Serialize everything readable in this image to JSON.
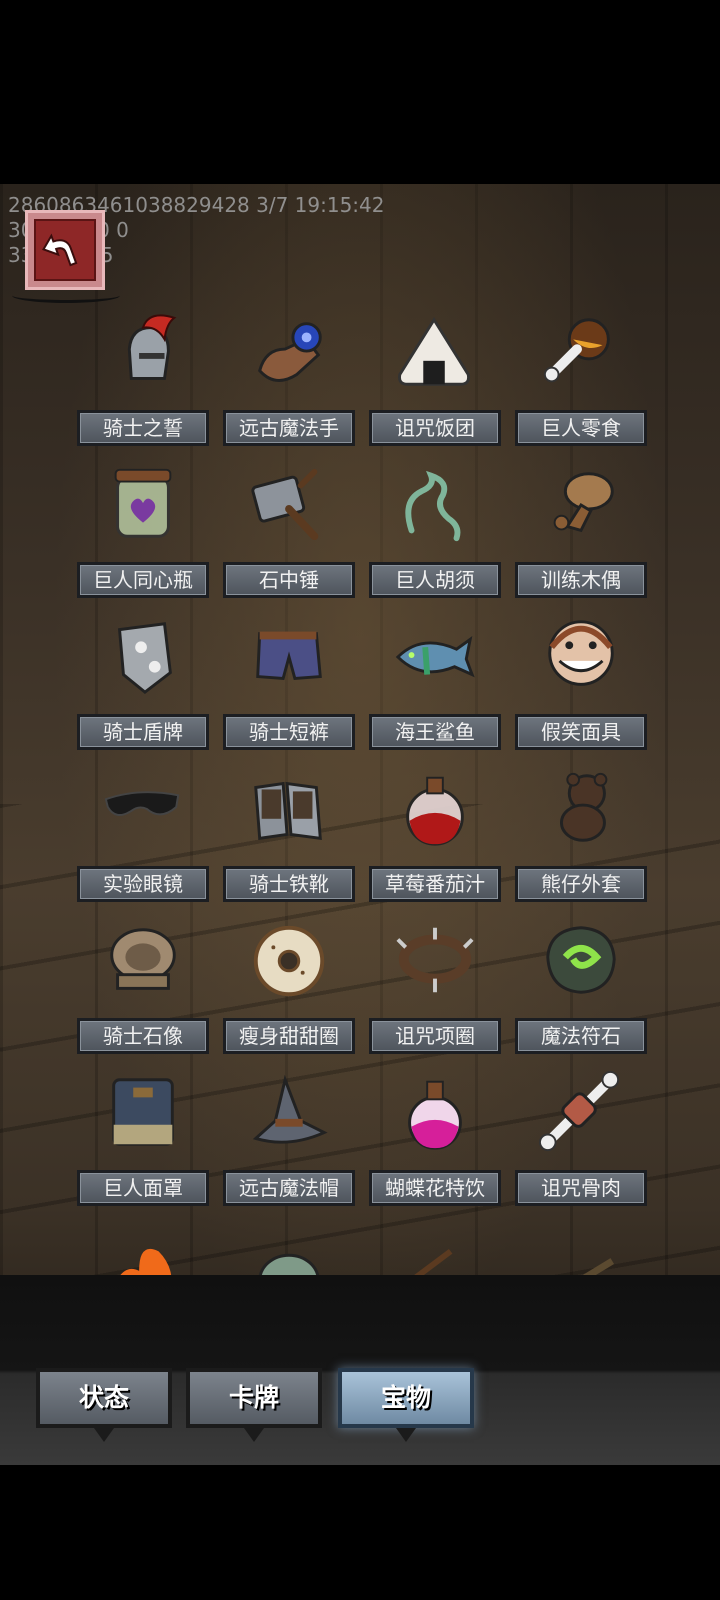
{
  "debug": {
    "line1": "2860863461038829428 3/7 19:15:42",
    "line2": "30005 0 0 0",
    "line3": "33837 5_5"
  },
  "back_button": {
    "icon": "back-arrow-icon"
  },
  "items": [
    {
      "label": "骑士之誓",
      "icon": "plumed-helmet-icon"
    },
    {
      "label": "远古魔法手",
      "icon": "armored-gauntlet-icon"
    },
    {
      "label": "诅咒饭团",
      "icon": "rice-ball-icon"
    },
    {
      "label": "巨人零食",
      "icon": "meat-bone-icon"
    },
    {
      "label": "巨人同心瓶",
      "icon": "heart-jar-icon"
    },
    {
      "label": "石中锤",
      "icon": "stone-hammer-icon"
    },
    {
      "label": "巨人胡须",
      "icon": "green-whisker-icon"
    },
    {
      "label": "训练木偶",
      "icon": "wooden-dummy-icon"
    },
    {
      "label": "骑士盾牌",
      "icon": "spiked-shield-icon"
    },
    {
      "label": "骑士短裤",
      "icon": "shorts-icon"
    },
    {
      "label": "海王鲨鱼",
      "icon": "shark-icon"
    },
    {
      "label": "假笑面具",
      "icon": "grin-mask-icon"
    },
    {
      "label": "实验眼镜",
      "icon": "sunglasses-icon"
    },
    {
      "label": "骑士铁靴",
      "icon": "iron-boots-icon"
    },
    {
      "label": "草莓番茄汁",
      "icon": "red-potion-icon"
    },
    {
      "label": "熊仔外套",
      "icon": "teddy-bear-icon"
    },
    {
      "label": "骑士石像",
      "icon": "stone-pedestal-icon"
    },
    {
      "label": "瘦身甜甜圈",
      "icon": "donut-icon"
    },
    {
      "label": "诅咒项圈",
      "icon": "spiked-collar-icon"
    },
    {
      "label": "魔法符石",
      "icon": "rune-stone-icon"
    },
    {
      "label": "巨人面罩",
      "icon": "face-guard-icon"
    },
    {
      "label": "远古魔法帽",
      "icon": "wizard-hat-icon"
    },
    {
      "label": "蝴蝶花特饮",
      "icon": "pink-potion-icon"
    },
    {
      "label": "诅咒骨肉",
      "icon": "bone-meat-icon"
    },
    {
      "label": "",
      "icon": "flame-icon"
    },
    {
      "label": "",
      "icon": "scaled-egg-icon"
    },
    {
      "label": "",
      "icon": "crossbow-icon"
    },
    {
      "label": "",
      "icon": "staff-icon"
    }
  ],
  "tabs": [
    {
      "label": "状态"
    },
    {
      "label": "卡牌"
    },
    {
      "label": "宝物"
    }
  ]
}
